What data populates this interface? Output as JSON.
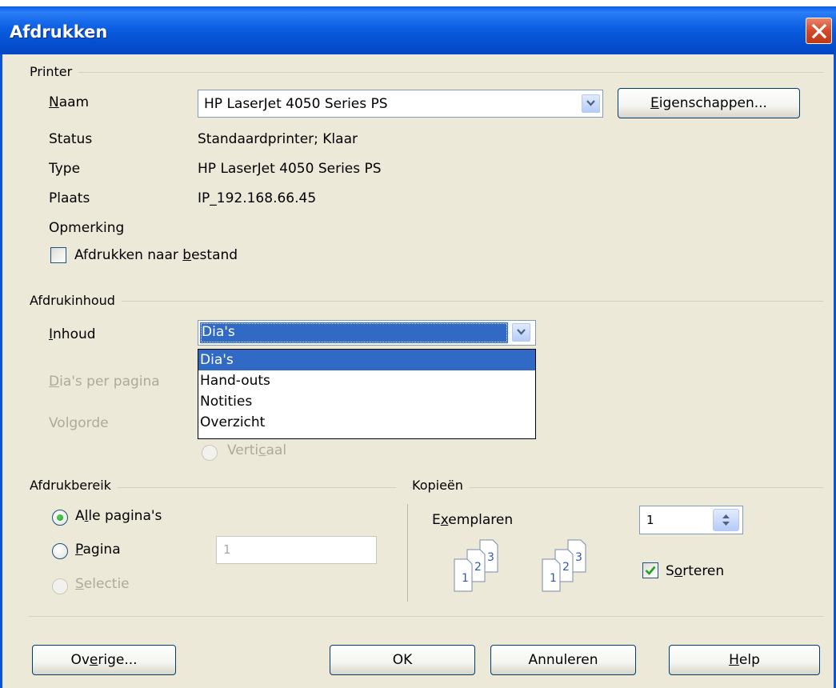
{
  "window": {
    "title": "Afdrukken"
  },
  "printer": {
    "group_label": "Printer",
    "name_label": "Naam",
    "name_value": "HP LaserJet 4050 Series PS",
    "properties_button": "Eigenschappen...",
    "status_label": "Status",
    "status_value": "Standaardprinter; Klaar",
    "type_label": "Type",
    "type_value": "HP LaserJet 4050 Series PS",
    "location_label": "Plaats",
    "location_value": "IP_192.168.66.45",
    "comment_label": "Opmerking",
    "print_to_file_label": "Afdrukken naar bestand",
    "print_to_file_checked": false
  },
  "content": {
    "group_label": "Afdrukinhoud",
    "content_label": "Inhoud",
    "content_value": "Dia's",
    "options": [
      "Dia's",
      "Hand-outs",
      "Notities",
      "Overzicht"
    ],
    "slides_per_page_label": "Dia's per pagina",
    "order_label": "Volgorde",
    "vertical_label": "Verticaal"
  },
  "range": {
    "group_label": "Afdrukbereik",
    "all_pages_label": "Alle pagina's",
    "pages_label": "Pagina",
    "pages_value": "1",
    "selection_label": "Selectie",
    "selected": "all"
  },
  "copies": {
    "group_label": "Kopieën",
    "copies_label": "Exemplaren",
    "copies_value": "1",
    "collate_label": "Sorteren",
    "collate_checked": true
  },
  "buttons": {
    "other": "Overige...",
    "ok": "OK",
    "cancel": "Annuleren",
    "help": "Help"
  },
  "colors": {
    "title_bar": "#0a5ce6",
    "selection": "#316ac5",
    "dialog_bg": "#ece9d8"
  }
}
